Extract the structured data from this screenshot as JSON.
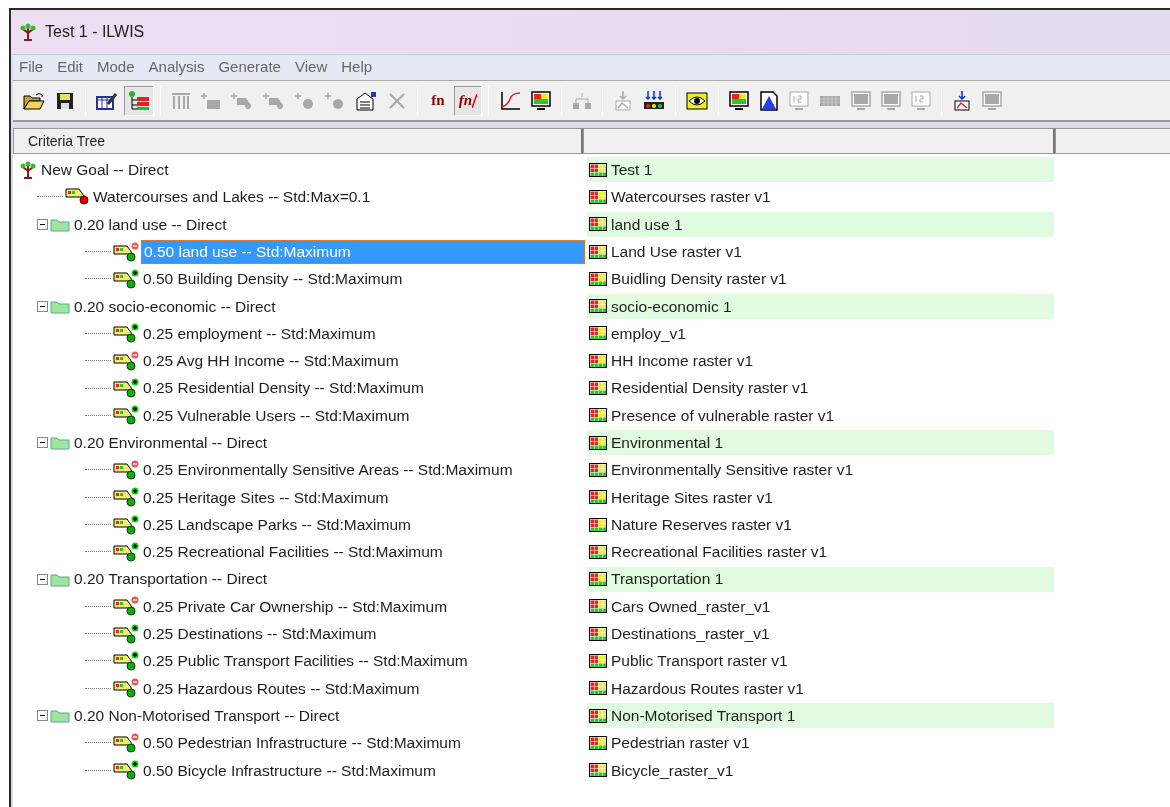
{
  "window": {
    "title": "Test 1 - ILWIS"
  },
  "menu": [
    "File",
    "Edit",
    "Mode",
    "Analysis",
    "Generate",
    "View",
    "Help"
  ],
  "toolbar": [
    {
      "kind": "open",
      "disabled": false,
      "pressed": false
    },
    {
      "kind": "save",
      "disabled": false,
      "pressed": false
    },
    {
      "kind": "separator"
    },
    {
      "kind": "edit",
      "disabled": false,
      "pressed": false
    },
    {
      "kind": "tree",
      "disabled": false,
      "pressed": true
    },
    {
      "kind": "separator"
    },
    {
      "kind": "columns",
      "disabled": true,
      "pressed": false
    },
    {
      "kind": "add-group",
      "disabled": true,
      "pressed": false
    },
    {
      "kind": "add-factor",
      "disabled": true,
      "pressed": false
    },
    {
      "kind": "add-factor",
      "disabled": true,
      "pressed": false
    },
    {
      "kind": "add-dot",
      "disabled": true,
      "pressed": false
    },
    {
      "kind": "add-dot",
      "disabled": true,
      "pressed": false
    },
    {
      "kind": "properties",
      "disabled": false,
      "pressed": false
    },
    {
      "kind": "delete",
      "disabled": true,
      "pressed": false
    },
    {
      "kind": "separator"
    },
    {
      "kind": "fn",
      "label": "fn",
      "disabled": false,
      "pressed": false
    },
    {
      "kind": "fn-off",
      "label": "fn",
      "disabled": false,
      "pressed": true
    },
    {
      "kind": "separator"
    },
    {
      "kind": "graph",
      "disabled": false,
      "pressed": false
    },
    {
      "kind": "display",
      "disabled": false,
      "pressed": false
    },
    {
      "kind": "separator"
    },
    {
      "kind": "network",
      "disabled": true,
      "pressed": false
    },
    {
      "kind": "separator"
    },
    {
      "kind": "import",
      "disabled": true,
      "pressed": false
    },
    {
      "kind": "batch",
      "disabled": false,
      "pressed": false
    },
    {
      "kind": "separator"
    },
    {
      "kind": "eye",
      "disabled": false,
      "pressed": false
    },
    {
      "kind": "separator"
    },
    {
      "kind": "display",
      "disabled": false,
      "pressed": false
    },
    {
      "kind": "histogram",
      "disabled": false,
      "pressed": false
    },
    {
      "kind": "number",
      "disabled": true,
      "pressed": false
    },
    {
      "kind": "grid",
      "disabled": true,
      "pressed": false
    },
    {
      "kind": "display",
      "disabled": true,
      "pressed": false
    },
    {
      "kind": "display",
      "disabled": true,
      "pressed": false
    },
    {
      "kind": "number",
      "disabled": true,
      "pressed": false
    },
    {
      "kind": "separator"
    },
    {
      "kind": "import",
      "disabled": false,
      "pressed": false
    },
    {
      "kind": "display",
      "disabled": true,
      "pressed": false
    }
  ],
  "columns": [
    "Criteria Tree"
  ],
  "tree": {
    "kind": "goal",
    "label": "New Goal -- Direct",
    "map": "Test 1",
    "selected": false,
    "children": [
      {
        "kind": "constraint",
        "label": "Watercourses and Lakes -- Std:Max=0.1",
        "map": "Watercourses raster v1",
        "selected": false
      },
      {
        "kind": "group",
        "label": "0.20 land use -- Direct",
        "map": "land use 1",
        "selected": false,
        "expanded": true,
        "children": [
          {
            "kind": "factor-minus",
            "label": "0.50 land use -- Std:Maximum",
            "map": "Land Use raster v1",
            "selected": true
          },
          {
            "kind": "factor-plus",
            "label": "0.50 Building Density -- Std:Maximum",
            "map": "Buidling Density raster v1",
            "selected": false
          }
        ]
      },
      {
        "kind": "group",
        "label": "0.20 socio-economic -- Direct",
        "map": "socio-economic 1",
        "selected": false,
        "expanded": true,
        "children": [
          {
            "kind": "factor-plus",
            "label": "0.25 employment -- Std:Maximum",
            "map": "employ_v1",
            "selected": false
          },
          {
            "kind": "factor-minus",
            "label": "0.25 Avg HH Income -- Std:Maximum",
            "map": "HH Income raster v1",
            "selected": false
          },
          {
            "kind": "factor-plus",
            "label": "0.25 Residential Density -- Std:Maximum",
            "map": "Residential Density raster v1",
            "selected": false
          },
          {
            "kind": "factor-plus",
            "label": "0.25 Vulnerable Users -- Std:Maximum",
            "map": "Presence of vulnerable raster v1",
            "selected": false
          }
        ]
      },
      {
        "kind": "group",
        "label": "0.20 Environmental -- Direct",
        "map": "Environmental 1",
        "selected": false,
        "expanded": true,
        "children": [
          {
            "kind": "factor-minus",
            "label": "0.25 Environmentally Sensitive Areas -- Std:Maximum",
            "map": "Environmentally Sensitive raster v1",
            "selected": false
          },
          {
            "kind": "factor-plus",
            "label": "0.25 Heritage Sites -- Std:Maximum",
            "map": "Heritage Sites raster v1",
            "selected": false
          },
          {
            "kind": "factor-plus",
            "label": "0.25 Landscape Parks -- Std:Maximum",
            "map": "Nature Reserves raster v1",
            "selected": false
          },
          {
            "kind": "factor-plus",
            "label": "0.25 Recreational Facilities -- Std:Maximum",
            "map": "Recreational Facilities raster v1",
            "selected": false
          }
        ]
      },
      {
        "kind": "group",
        "label": "0.20 Transportation -- Direct",
        "map": "Transportation 1",
        "selected": false,
        "expanded": true,
        "children": [
          {
            "kind": "factor-minus",
            "label": "0.25 Private Car Ownership -- Std:Maximum",
            "map": "Cars Owned_raster_v1",
            "selected": false
          },
          {
            "kind": "factor-plus",
            "label": "0.25 Destinations -- Std:Maximum",
            "map": "Destinations_raster_v1",
            "selected": false
          },
          {
            "kind": "factor-plus",
            "label": "0.25 Public Transport Facilities -- Std:Maximum",
            "map": "Public Transport raster v1",
            "selected": false
          },
          {
            "kind": "factor-minus",
            "label": "0.25 Hazardous Routes -- Std:Maximum",
            "map": "Hazardous Routes raster v1",
            "selected": false
          }
        ]
      },
      {
        "kind": "group",
        "label": "0.20 Non-Motorised Transport -- Direct",
        "map": "Non-Motorised Transport 1",
        "selected": false,
        "expanded": true,
        "children": [
          {
            "kind": "factor-minus",
            "label": "0.50 Pedestrian Infrastructure -- Std:Maximum",
            "map": "Pedestrian raster v1",
            "selected": false
          },
          {
            "kind": "factor-plus",
            "label": "0.50 Bicycle Infrastructure -- Std:Maximum",
            "map": "Bicycle_raster_v1",
            "selected": false
          }
        ]
      }
    ]
  }
}
